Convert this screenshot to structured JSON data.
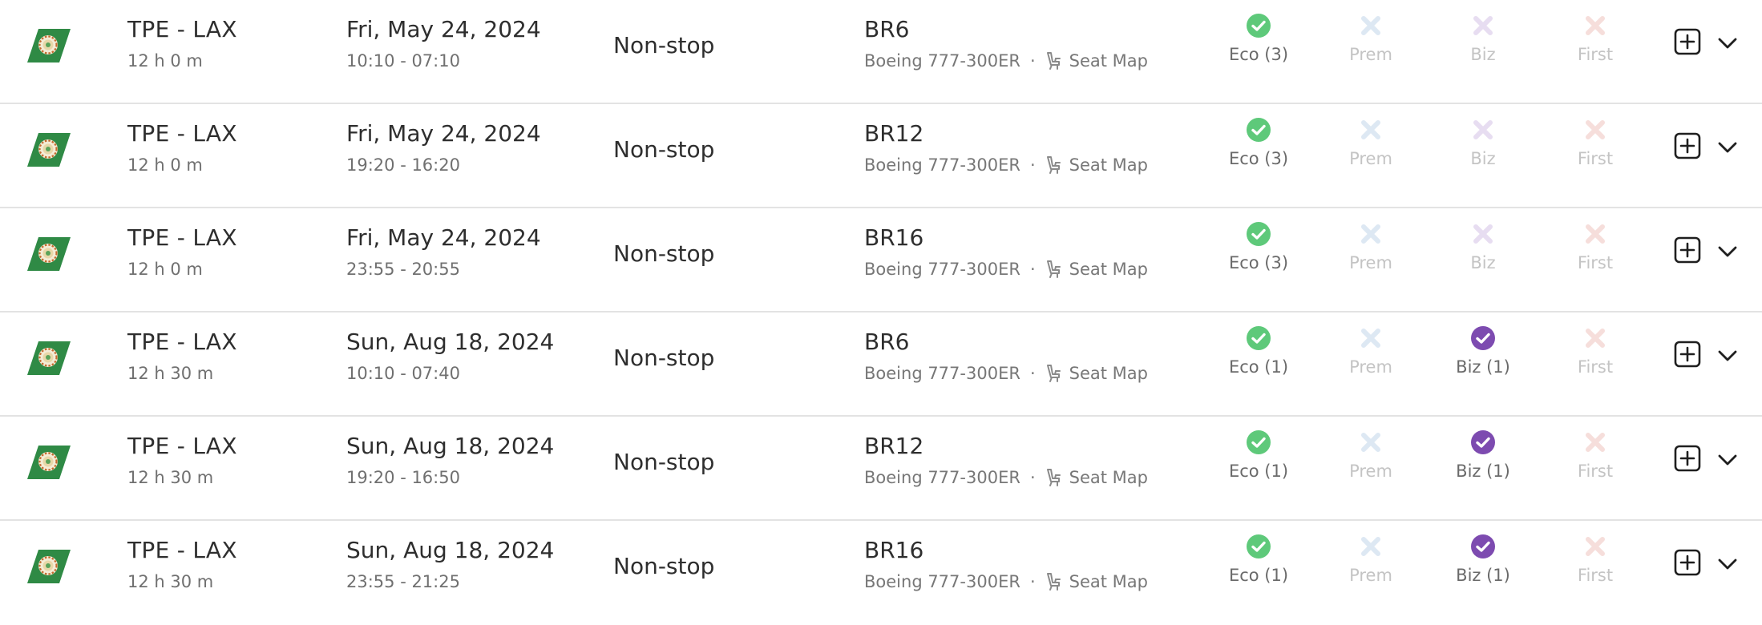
{
  "colors": {
    "eco_available": "#5ec97a",
    "biz_available": "#7d4bb0",
    "prem_unavailable": "#dde8f3",
    "biz_unavailable": "#e7ddf1",
    "first_unavailable": "#f6dedb",
    "airline_logo_green": "#2f8a45"
  },
  "icons": {
    "airline_logo": "eva-air-tail-logo-icon",
    "available": "check-circle-icon",
    "unavailable": "x-icon",
    "seat": "seat-icon",
    "add": "plus-square-icon",
    "expand": "chevron-down-icon"
  },
  "flights": [
    {
      "route": "TPE - LAX",
      "duration": "12 h 0 m",
      "date": "Fri, May 24, 2024",
      "times": "10:10 - 07:10",
      "stops": "Non-stop",
      "flight_number": "BR6",
      "aircraft": "Boeing 777-300ER",
      "separator": "·",
      "seat_map": "Seat Map",
      "cabins": {
        "eco": {
          "label": "Eco (3)",
          "available": true
        },
        "prem": {
          "label": "Prem",
          "available": false
        },
        "biz": {
          "label": "Biz",
          "available": false
        },
        "first": {
          "label": "First",
          "available": false
        }
      }
    },
    {
      "route": "TPE - LAX",
      "duration": "12 h 0 m",
      "date": "Fri, May 24, 2024",
      "times": "19:20 - 16:20",
      "stops": "Non-stop",
      "flight_number": "BR12",
      "aircraft": "Boeing 777-300ER",
      "separator": "·",
      "seat_map": "Seat Map",
      "cabins": {
        "eco": {
          "label": "Eco (3)",
          "available": true
        },
        "prem": {
          "label": "Prem",
          "available": false
        },
        "biz": {
          "label": "Biz",
          "available": false
        },
        "first": {
          "label": "First",
          "available": false
        }
      }
    },
    {
      "route": "TPE - LAX",
      "duration": "12 h 0 m",
      "date": "Fri, May 24, 2024",
      "times": "23:55 - 20:55",
      "stops": "Non-stop",
      "flight_number": "BR16",
      "aircraft": "Boeing 777-300ER",
      "separator": "·",
      "seat_map": "Seat Map",
      "cabins": {
        "eco": {
          "label": "Eco (3)",
          "available": true
        },
        "prem": {
          "label": "Prem",
          "available": false
        },
        "biz": {
          "label": "Biz",
          "available": false
        },
        "first": {
          "label": "First",
          "available": false
        }
      }
    },
    {
      "route": "TPE - LAX",
      "duration": "12 h 30 m",
      "date": "Sun, Aug 18, 2024",
      "times": "10:10 - 07:40",
      "stops": "Non-stop",
      "flight_number": "BR6",
      "aircraft": "Boeing 777-300ER",
      "separator": "·",
      "seat_map": "Seat Map",
      "cabins": {
        "eco": {
          "label": "Eco (1)",
          "available": true
        },
        "prem": {
          "label": "Prem",
          "available": false
        },
        "biz": {
          "label": "Biz (1)",
          "available": true
        },
        "first": {
          "label": "First",
          "available": false
        }
      }
    },
    {
      "route": "TPE - LAX",
      "duration": "12 h 30 m",
      "date": "Sun, Aug 18, 2024",
      "times": "19:20 - 16:50",
      "stops": "Non-stop",
      "flight_number": "BR12",
      "aircraft": "Boeing 777-300ER",
      "separator": "·",
      "seat_map": "Seat Map",
      "cabins": {
        "eco": {
          "label": "Eco (1)",
          "available": true
        },
        "prem": {
          "label": "Prem",
          "available": false
        },
        "biz": {
          "label": "Biz (1)",
          "available": true
        },
        "first": {
          "label": "First",
          "available": false
        }
      }
    },
    {
      "route": "TPE - LAX",
      "duration": "12 h 30 m",
      "date": "Sun, Aug 18, 2024",
      "times": "23:55 - 21:25",
      "stops": "Non-stop",
      "flight_number": "BR16",
      "aircraft": "Boeing 777-300ER",
      "separator": "·",
      "seat_map": "Seat Map",
      "cabins": {
        "eco": {
          "label": "Eco (1)",
          "available": true
        },
        "prem": {
          "label": "Prem",
          "available": false
        },
        "biz": {
          "label": "Biz (1)",
          "available": true
        },
        "first": {
          "label": "First",
          "available": false
        }
      }
    }
  ]
}
